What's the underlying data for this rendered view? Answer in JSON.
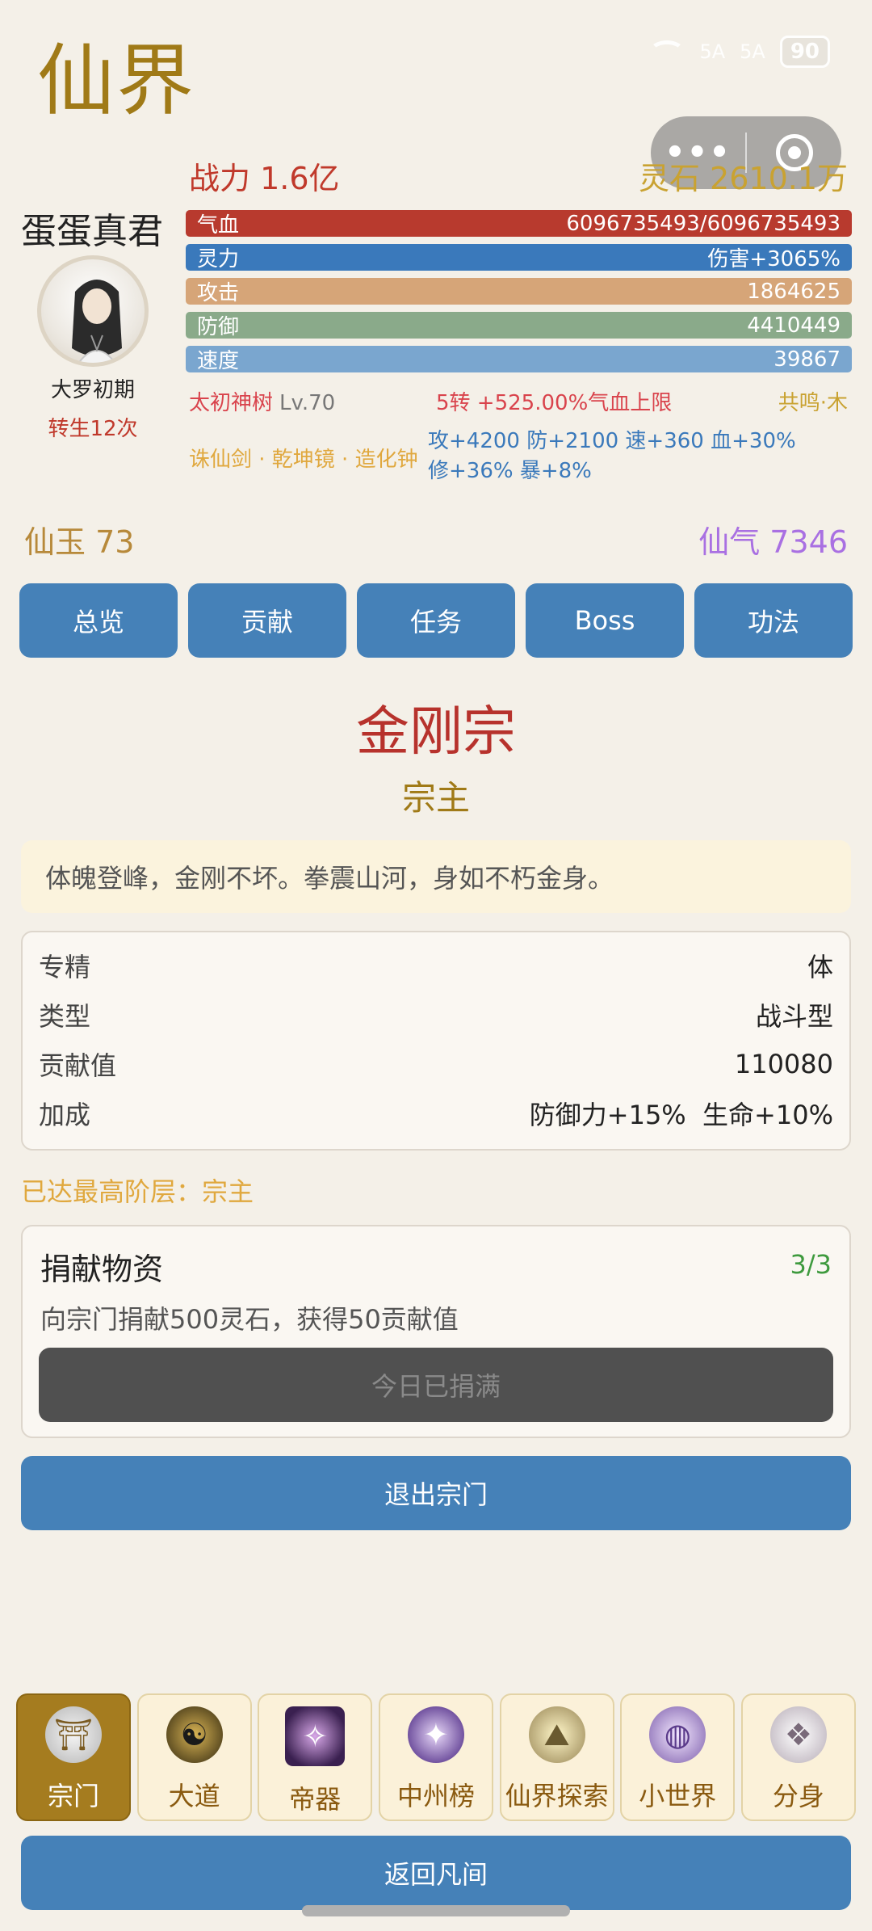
{
  "app_title": "仙界",
  "status_bar": {
    "signal1": "5A",
    "signal2": "5A",
    "battery": "90"
  },
  "player": {
    "power": "战力 1.6亿",
    "stones": "灵石 2610.1万",
    "name": "蛋蛋真君",
    "realm": "大罗初期",
    "rebirth": "转生12次"
  },
  "stats": {
    "hp": {
      "label": "气血",
      "value": "6096735493/6096735493"
    },
    "mp": {
      "label": "灵力",
      "value": "伤害+3065%"
    },
    "atk": {
      "label": "攻击",
      "value": "1864625"
    },
    "def": {
      "label": "防御",
      "value": "4410449"
    },
    "spd": {
      "label": "速度",
      "value": "39867"
    }
  },
  "tree": {
    "name": "太初神树",
    "level": "Lv.70"
  },
  "rebirth_bonus": "5转 +525.00%气血上限",
  "resonance": "共鸣·木",
  "artifacts": "诛仙剑 · 乾坤镜 · 造化钟",
  "artifact_stats": {
    "line1": "攻+4200 防+2100 速+360 血+30%",
    "line2": "修+36% 暴+8%"
  },
  "currency": {
    "jade": "仙玉 73",
    "qi": "仙气 7346"
  },
  "tabs": [
    "总览",
    "贡献",
    "任务",
    "Boss",
    "功法"
  ],
  "sect": {
    "name": "金刚宗",
    "rank": "宗主",
    "motto": "体魄登峰，金刚不坏。拳震山河，身如不朽金身。",
    "info": [
      {
        "label": "专精",
        "value": "体"
      },
      {
        "label": "类型",
        "value": "战斗型"
      },
      {
        "label": "贡献值",
        "value": "110080"
      },
      {
        "label": "加成",
        "value": "防御力+15%  生命+10%"
      }
    ],
    "top_rank": "已达最高阶层：宗主"
  },
  "donate": {
    "title": "捐献物资",
    "count": "3/3",
    "desc": "向宗门捐献500灵石，获得50贡献值",
    "button": "今日已捐满"
  },
  "leave_button": "退出宗门",
  "bottom_nav": [
    {
      "label": "宗门",
      "icon": "temple-icon",
      "glyph": "⛩",
      "active": true
    },
    {
      "label": "大道",
      "icon": "bagua-icon",
      "glyph": "☯",
      "active": false
    },
    {
      "label": "帝器",
      "icon": "artifact-icon",
      "glyph": "✧",
      "active": false
    },
    {
      "label": "中州榜",
      "icon": "ranking-icon",
      "glyph": "✦",
      "active": false
    },
    {
      "label": "仙界探索",
      "icon": "explore-icon",
      "glyph": "⛰",
      "active": false
    },
    {
      "label": "小世界",
      "icon": "world-icon",
      "glyph": "◍",
      "active": false
    },
    {
      "label": "分身",
      "icon": "clone-icon",
      "glyph": "❖",
      "active": false
    }
  ],
  "return_button": "返回凡间"
}
